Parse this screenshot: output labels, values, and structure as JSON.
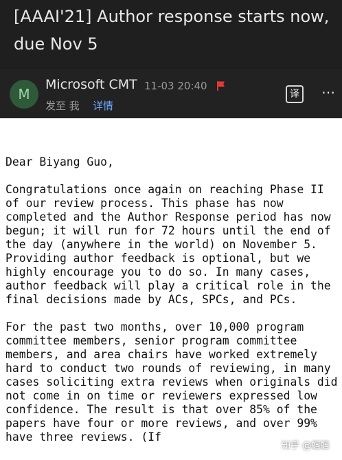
{
  "email": {
    "subject": "[AAAI'21] Author response starts now, due Nov 5",
    "sender_initial": "M",
    "sender": "Microsoft CMT",
    "time": "11-03 20:40",
    "to_label": "发至 我",
    "details_label": "详情",
    "translate_icon_label": "译",
    "more_icon_label": "⋯",
    "colors": {
      "header_bg": "#1f1f1f",
      "flag": "#e53935",
      "link": "#6ea8ff",
      "avatar_bg": "#2f5a3a"
    }
  },
  "body": {
    "greeting": "Dear Biyang Guo,",
    "paragraph_1": "Congratulations once again on reaching Phase II of our review process. This phase has now completed and the Author Response period has now begun; it will run for 72 hours until the end of the day (anywhere in the world) on November 5. Providing author feedback is optional, but we highly encourage you to do so. In many cases, author feedback will play a critical role in the final decisions made by ACs, SPCs, and PCs.",
    "paragraph_2": "For the past two months, over 10,000 program committee members, senior program committee members, and area chairs have worked extremely hard to conduct two rounds of reviewing, in many cases soliciting extra reviews when originals did not come in on time or reviewers expressed low confidence. The result is that over 85% of the papers have four or more reviews, and over 99% have three reviews. (If"
  },
  "watermark": "知乎 @蝈蝈"
}
